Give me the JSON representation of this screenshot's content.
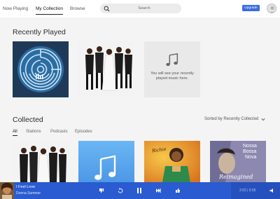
{
  "nav": {
    "items": [
      {
        "label": "Now Playing"
      },
      {
        "label": "My Collection",
        "active": true
      },
      {
        "label": "Browse"
      }
    ],
    "search_placeholder": "Search",
    "upgrade_label": "Upgrade"
  },
  "recently_played": {
    "title": "Recently Played",
    "placeholder_text": "You will see your recently played music here."
  },
  "collected": {
    "title": "Collected",
    "sort_label": "Sorted by Recently Collected",
    "filters": [
      {
        "label": "All",
        "active": true
      },
      {
        "label": "Stations"
      },
      {
        "label": "Podcasts"
      },
      {
        "label": "Episodes"
      }
    ],
    "album_text": {
      "richie": "Richie",
      "bossa_line1": "Nossa",
      "bossa_line2": "Bossa",
      "bossa_line3": "Nova",
      "bossa_script": "Reimagined"
    }
  },
  "player": {
    "title": "I Feel Love",
    "artist": "Donna Summer",
    "elapsed": "2:02",
    "duration": "5:55",
    "time_display": "2:02 | 5:55"
  },
  "colors": {
    "accent": "#2a5bd0",
    "upgrade": "#3a6de0",
    "background": "#f4f4f4"
  },
  "icons": [
    "search-icon",
    "avatar-icon",
    "music-note-icon",
    "chevron-down-icon",
    "thumbs-down-icon",
    "replay-icon",
    "pause-icon",
    "skip-icon",
    "thumbs-up-icon",
    "volume-icon"
  ]
}
